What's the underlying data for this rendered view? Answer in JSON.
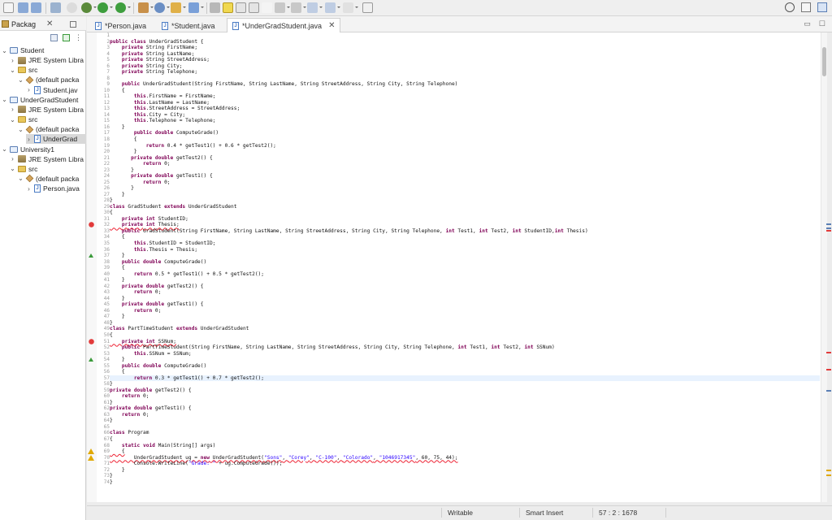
{
  "toolbar": {
    "icons": [
      "new-file-icon",
      "save-icon",
      "save-all-icon",
      "print-icon",
      "debug-icon",
      "run-icon",
      "run-config-icon",
      "coverage-icon",
      "new-java-project-icon",
      "new-package-icon",
      "new-class-icon",
      "open-type-icon",
      "search-icon",
      "toggle-mark-icon",
      "toggle-whitespace-icon",
      "annotation-icon",
      "next-annotation-icon",
      "prev-edit-icon",
      "back-icon",
      "forward-icon",
      "pin-icon"
    ]
  },
  "package_explorer": {
    "title": "Packag",
    "items": [
      {
        "label": "Student",
        "level": 0,
        "icon": "project-icon",
        "expanded": true
      },
      {
        "label": "JRE System Libra",
        "level": 1,
        "icon": "library-icon",
        "expanded": false
      },
      {
        "label": "src",
        "level": 1,
        "icon": "source-folder-icon",
        "expanded": true
      },
      {
        "label": "(default packa",
        "level": 2,
        "icon": "package-icon",
        "expanded": true
      },
      {
        "label": "Student.jav",
        "level": 3,
        "icon": "java-file-icon",
        "expanded": false
      },
      {
        "label": "UnderGradStudent",
        "level": 0,
        "icon": "project-icon",
        "expanded": true
      },
      {
        "label": "JRE System Libra",
        "level": 1,
        "icon": "library-icon",
        "expanded": false
      },
      {
        "label": "src",
        "level": 1,
        "icon": "source-folder-icon",
        "expanded": true
      },
      {
        "label": "(default packa",
        "level": 2,
        "icon": "package-icon",
        "expanded": true
      },
      {
        "label": "UnderGrad",
        "level": 3,
        "icon": "java-file-icon",
        "expanded": false,
        "selected": true
      },
      {
        "label": "University1",
        "level": 0,
        "icon": "project-icon",
        "expanded": true
      },
      {
        "label": "JRE System Libra",
        "level": 1,
        "icon": "library-icon",
        "expanded": false
      },
      {
        "label": "src",
        "level": 1,
        "icon": "source-folder-icon",
        "expanded": true
      },
      {
        "label": "(default packa",
        "level": 2,
        "icon": "package-icon",
        "expanded": true
      },
      {
        "label": "Person.java",
        "level": 3,
        "icon": "java-file-icon",
        "expanded": false
      }
    ]
  },
  "editor_tabs": [
    {
      "label": "*Person.java",
      "active": false
    },
    {
      "label": "*Student.java",
      "active": false
    },
    {
      "label": "*UnderGradStudent.java",
      "active": true,
      "close": "✕"
    }
  ],
  "code_lines": [
    "",
    "public class UnderGradStudent {",
    "    private String FirstName;",
    "    private String LastName;",
    "    private String StreetAddress;",
    "    private String City;",
    "    private String Telephone;",
    "",
    "    public UnderGradStudent(String FirstName, String LastName, String StreetAddress, String City, String Telephone)",
    "    {",
    "        this.FirstName = FirstName;",
    "        this.LastName = LastName;",
    "        this.StreetAddress = StreetAddress;",
    "        this.City = City;",
    "        this.Telephone = Telephone;",
    "    }",
    "        public double ComputeGrade()",
    "        {",
    "            return 0.4 * getTest1() + 0.6 * getTest2();",
    "        }",
    "       private double getTest2() {",
    "           return 0;",
    "       }",
    "       private double getTest1() {",
    "           return 0;",
    "       }",
    "    }",
    "}",
    "class GradStudent extends UnderGradStudent",
    "{",
    "    private int StudentID;",
    "    private int Thesis;",
    "    public GradStudent(String FirstName, String LastName, String StreetAddress, String City, String Telephone, int Test1, int Test2, int StudentID,int Thesis)",
    "    {",
    "        this.StudentID = StudentID;",
    "        this.Thesis = Thesis;",
    "    }",
    "    public double ComputeGrade()",
    "    {",
    "        return 0.5 * getTest1() + 0.5 * getTest2();",
    "    }",
    "    private double getTest2() {",
    "        return 0;",
    "    }",
    "    private double getTest1() {",
    "        return 0;",
    "    }",
    "}",
    "class PartTimeStudent extends UnderGradStudent",
    "{",
    "    private int SSNum;",
    "    public PartTimeStudent(String FirstName, String LastName, String StreetAddress, String City, String Telephone, int Test1, int Test2, int SSNum)",
    "        this.SSNum = SSNum;",
    "    }",
    "    public double ComputeGrade()",
    "    {",
    "        return 0.3 * getTest1() + 0.7 * getTest2();",
    "}",
    "private double getTest2() {",
    "    return 0;",
    "}",
    "private double getTest1() {",
    "    return 0;",
    "}",
    "",
    "class Program",
    "{",
    "    static void Main(String[] args)",
    "    {",
    "        UnderGradStudent ug = new UnderGradStudent(\"Sons\", \"Corey\", \"C-100\", \"Colorado\", \"1046917345\", 60, 75, 44);",
    "        Console.WriteLine(\"Grade: \" + ug.ComputeGrade());",
    "    }",
    "}",
    "}"
  ],
  "status": {
    "writable": "Writable",
    "insert_mode": "Smart Insert",
    "position": "57 : 2 : 1678"
  },
  "colors": {
    "keyword": "#7f0055",
    "field": "#0000c0",
    "string": "#2a00ff",
    "error": "#e23b3b",
    "warning": "#e0a800"
  }
}
